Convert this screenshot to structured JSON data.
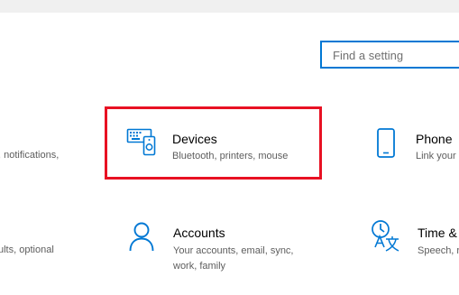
{
  "search": {
    "placeholder": "Find a setting"
  },
  "tiles": {
    "devices": {
      "title": "Devices",
      "subtitle": "Bluetooth, printers, mouse",
      "icon": "devices-icon"
    },
    "phone": {
      "title": "Phone",
      "subtitle": "Link your",
      "icon": "phone-icon"
    },
    "accounts": {
      "title": "Accounts",
      "subtitle_line1": "Your accounts, email, sync,",
      "subtitle_line2": "work, family",
      "icon": "person-icon"
    },
    "time": {
      "title": "Time &",
      "subtitle": "Speech, re",
      "icon": "time-language-icon"
    }
  },
  "left_clipped": {
    "row1": ", notifications,",
    "row2": "ults, optional"
  },
  "colors": {
    "accent": "#0078d4",
    "highlight": "#e81123"
  }
}
